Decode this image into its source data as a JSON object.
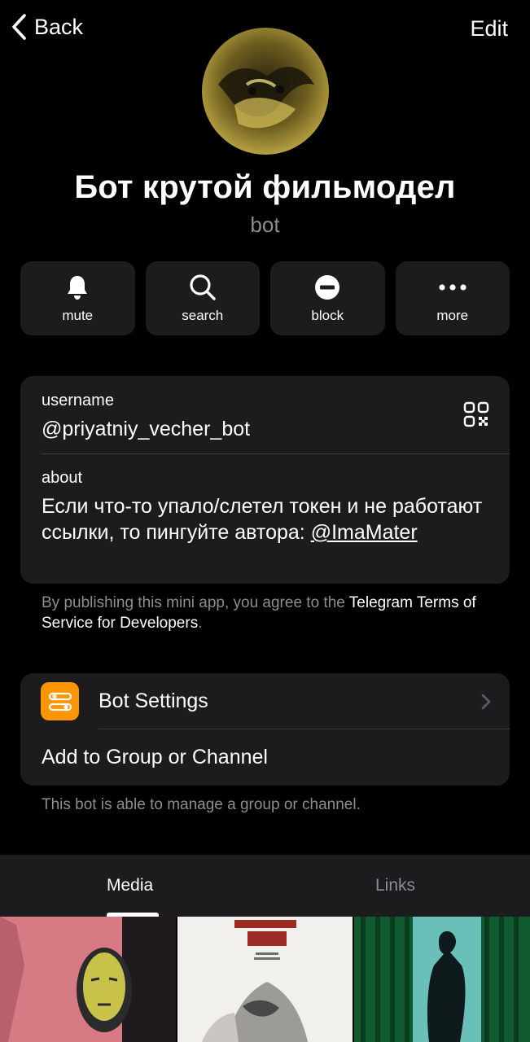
{
  "nav": {
    "back_label": "Back",
    "edit_label": "Edit"
  },
  "profile": {
    "name": "Бот крутой фильмодел",
    "type": "bot"
  },
  "actions": [
    {
      "label": "mute",
      "icon": "bell-icon"
    },
    {
      "label": "search",
      "icon": "search-icon"
    },
    {
      "label": "block",
      "icon": "block-icon"
    },
    {
      "label": "more",
      "icon": "more-icon"
    }
  ],
  "info": {
    "username_label": "username",
    "username_value": "@priyatniy_vecher_bot",
    "about_label": "about",
    "about_text": "Если что-то упало/слетел токен и не работают ссылки, то пингуйте автора: ",
    "about_link": "@ImaMater"
  },
  "mini_app_note": {
    "prefix": "By publishing this mini app, you agree to the ",
    "link": "Telegram Terms of Service for Developers",
    "suffix": "."
  },
  "settings": {
    "bot_settings_label": "Bot Settings",
    "add_group_label": "Add to Group or Channel",
    "note": "This bot is able to manage a group or channel."
  },
  "tabs": {
    "media": "Media",
    "links": "Links"
  },
  "colors": {
    "accent_orange": "#ff9500",
    "card_bg": "#1c1c1e",
    "secondary_text": "#8d8d92"
  }
}
